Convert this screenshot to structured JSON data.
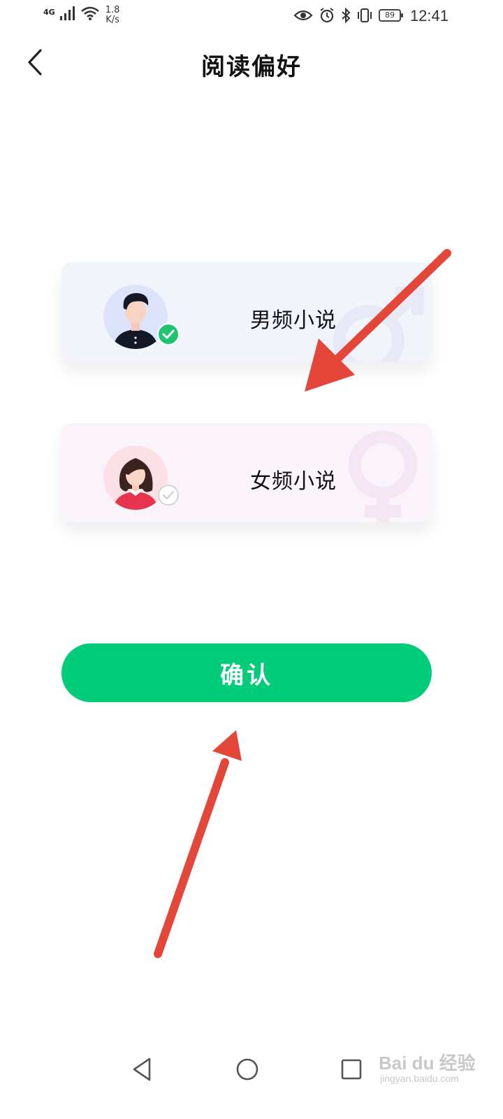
{
  "status_bar": {
    "network": "4G",
    "speed_value": "1.8",
    "speed_unit": "K/s",
    "battery": "89",
    "time": "12:41"
  },
  "header": {
    "title": "阅读偏好"
  },
  "options": [
    {
      "label": "男频小说",
      "selected": true
    },
    {
      "label": "女频小说",
      "selected": false
    }
  ],
  "confirm_label": "确认",
  "watermark": {
    "main": "Bai du 经验",
    "sub": "jingyan.baidu.com"
  },
  "colors": {
    "accent": "#00cc7a",
    "check": "#1ec46f",
    "male_card_bg": "#f2f4fb",
    "female_card_bg": "#fbf3fa",
    "annotation_arrow": "#e5463a"
  },
  "icons": {
    "back": "chevron-left-icon",
    "nav_back": "triangle-back-icon",
    "nav_home": "circle-home-icon",
    "nav_recent": "square-recent-icon"
  }
}
